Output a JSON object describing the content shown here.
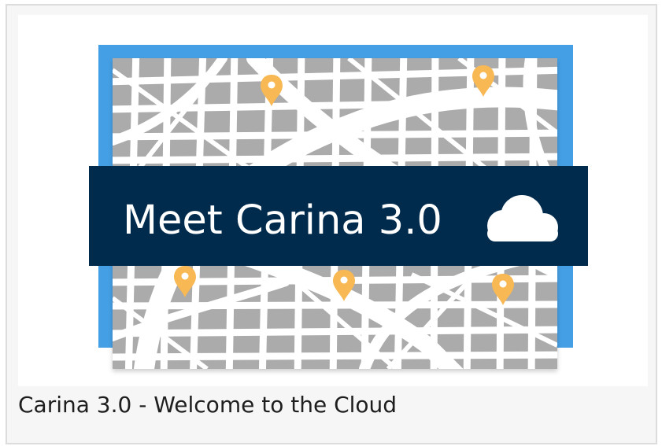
{
  "banner": {
    "title": "Meet Carina 3.0",
    "icon": "cloud-icon"
  },
  "caption": {
    "text": "Carina 3.0 - Welcome to the Cloud"
  },
  "colors": {
    "frame_blue": "#459fe4",
    "banner_navy": "#002b4d",
    "map_block": "#ababab",
    "map_road": "#ffffff",
    "pin_orange": "#f8b853",
    "caption_text": "#1e1e1e"
  }
}
